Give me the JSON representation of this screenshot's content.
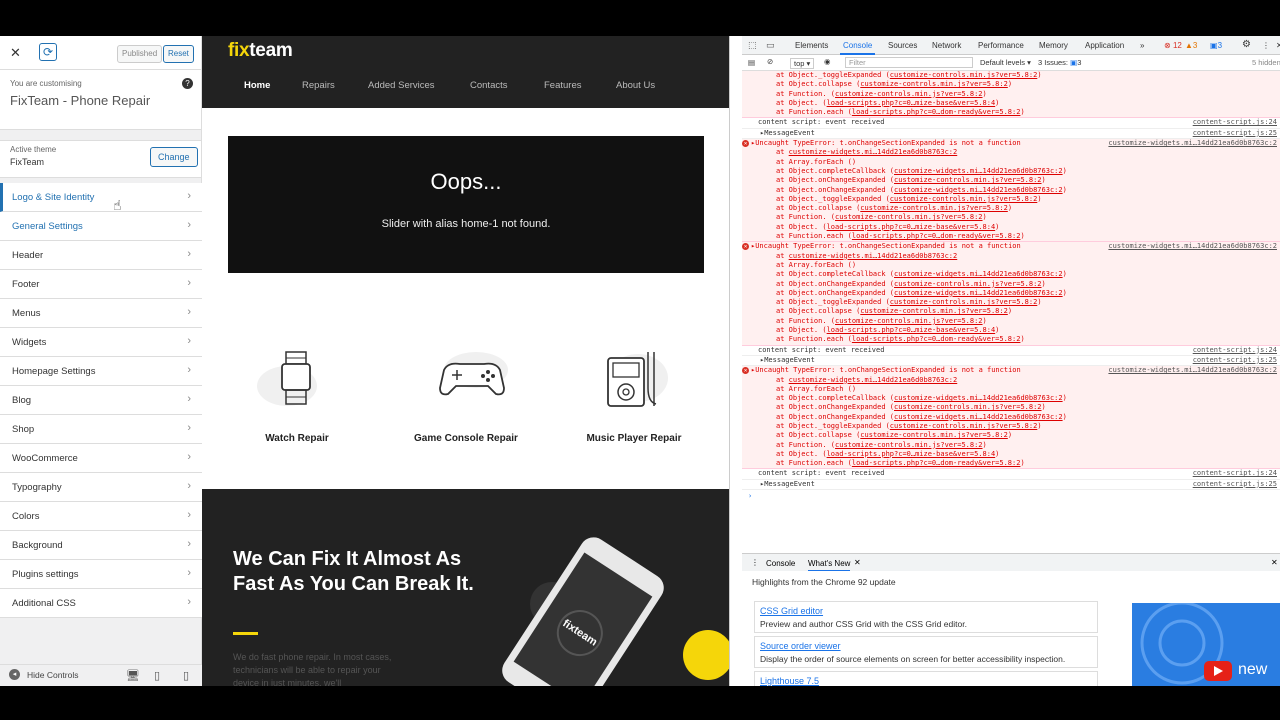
{
  "customizer": {
    "close": "✕",
    "published": "Published",
    "reset": "Reset",
    "customising_label": "You are customising",
    "site_name": "FixTeam - Phone Repair",
    "active_theme_label": "Active theme",
    "theme_name": "FixTeam",
    "change_btn": "Change",
    "menu": [
      {
        "label": "Logo & Site Identity"
      },
      {
        "label": "General Settings"
      },
      {
        "label": "Header"
      },
      {
        "label": "Footer"
      },
      {
        "label": "Menus"
      },
      {
        "label": "Widgets"
      },
      {
        "label": "Homepage Settings"
      },
      {
        "label": "Blog"
      },
      {
        "label": "Shop"
      },
      {
        "label": "WooCommerce"
      },
      {
        "label": "Typography"
      },
      {
        "label": "Colors"
      },
      {
        "label": "Background"
      },
      {
        "label": "Plugins settings"
      },
      {
        "label": "Additional CSS"
      }
    ],
    "hide_controls": "Hide Controls"
  },
  "site": {
    "logo_a": "fix",
    "logo_b": "team",
    "nav": [
      "Home",
      "Repairs",
      "Added Services",
      "Contacts",
      "Features",
      "About Us"
    ],
    "slider_title": "Oops...",
    "slider_msg": "Slider with alias home-1 not found.",
    "services": [
      "Watch Repair",
      "Game Console Repair",
      "Music Player Repair"
    ],
    "headline": "We Can Fix It Almost As Fast As You Can Break It.",
    "body": "We do fast phone repair. In most cases, technicians will be able to repair your device in just minutes, we'll",
    "phone_logo": "fixteam",
    "accent": "#f5d60a"
  },
  "devtools": {
    "tabs": [
      "Elements",
      "Console",
      "Sources",
      "Network",
      "Performance",
      "Memory",
      "Application",
      "»"
    ],
    "errors": "12",
    "warnings": "3",
    "infos": "3",
    "context": "top ▾",
    "filter_placeholder": "Filter",
    "levels": "Default levels ▾",
    "issues": "3 Issues:",
    "issues_count": "3",
    "hidden": "5 hidden",
    "drawer_tabs": [
      "Console",
      "What's New"
    ],
    "highlights": "Highlights from the Chrome 92 update",
    "cards": [
      {
        "title": "CSS Grid editor",
        "desc": "Preview and author CSS Grid with the CSS Grid editor."
      },
      {
        "title": "Source order viewer",
        "desc": "Display the order of source elements on screen for better accessibility inspection."
      },
      {
        "title": "Lighthouse 7.5",
        "desc": ""
      }
    ],
    "thumb_text": "new"
  }
}
